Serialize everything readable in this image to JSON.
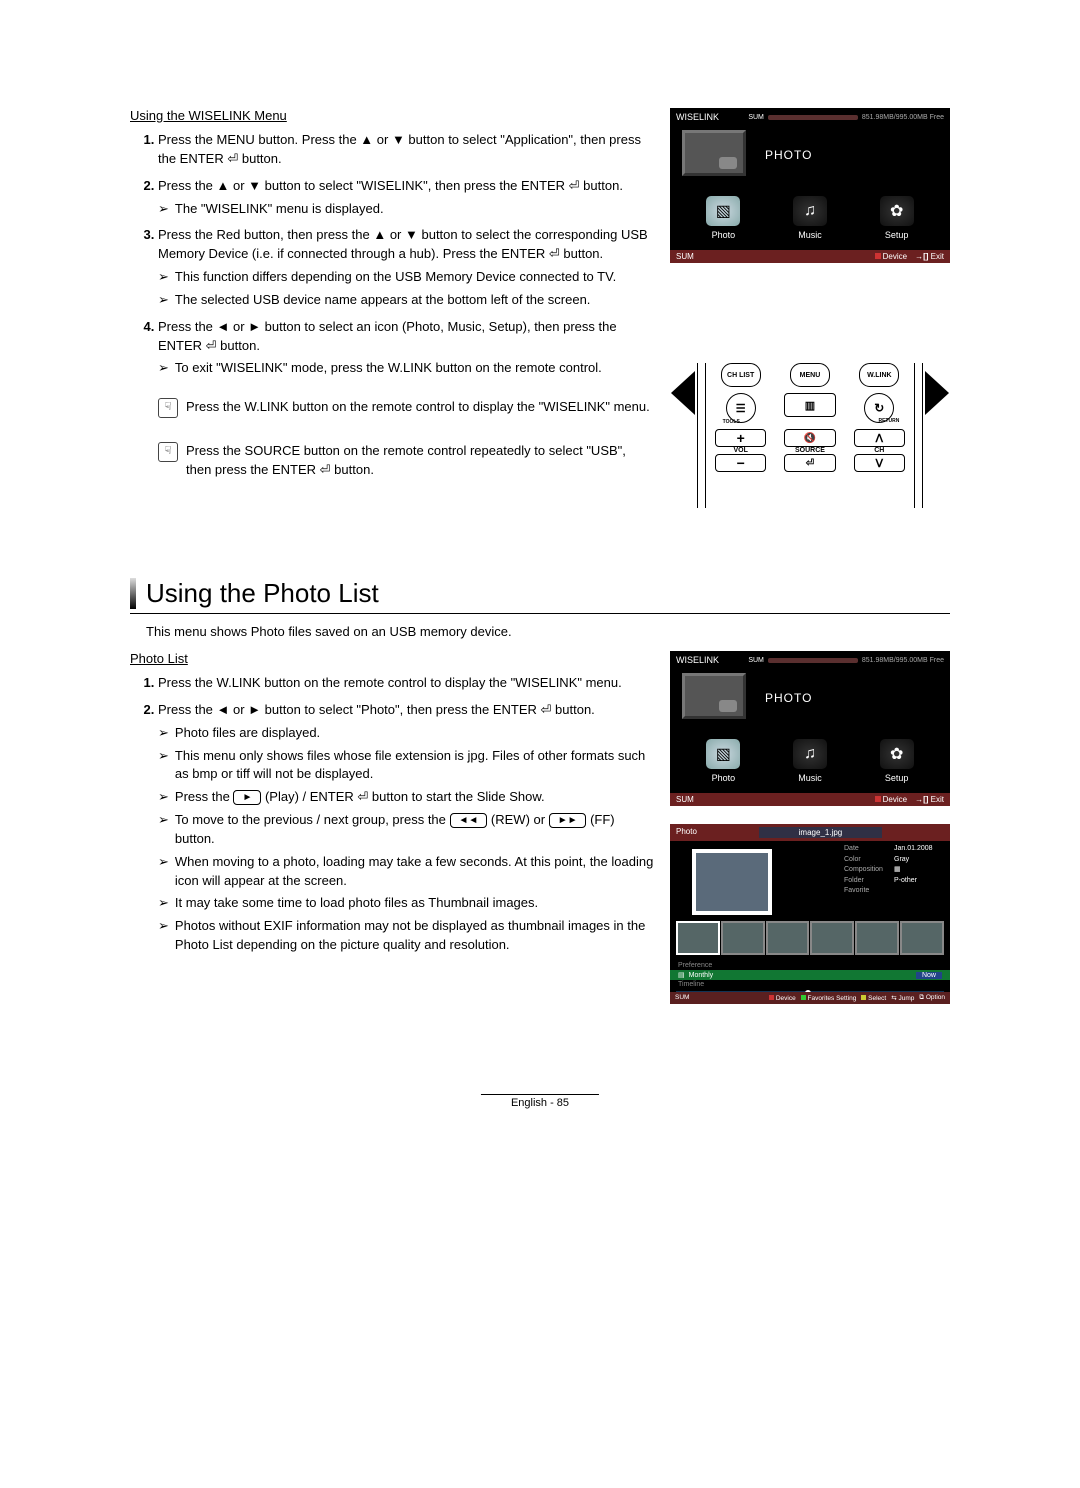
{
  "section1_title": "Using the WISELINK Menu",
  "steps1": {
    "s1": "Press the MENU button. Press the ▲ or ▼ button to select \"Application\", then press the ENTER ⏎ button.",
    "s2": "Press the ▲ or ▼ button to select \"WISELINK\", then press the ENTER ⏎ button.",
    "s2n1": "The \"WISELINK\" menu is displayed.",
    "s3": "Press the Red button, then press the ▲ or ▼ button to select the corresponding USB Memory Device (i.e. if connected through a hub). Press the ENTER ⏎ button.",
    "s3n1": "This function differs depending on the USB Memory Device connected to TV.",
    "s3n2": "The selected USB device name appears at the bottom left of the screen.",
    "s4": "Press the ◄ or ► button to select an icon (Photo, Music, Setup), then press the ENTER ⏎ button.",
    "s4n1": "To exit \"WISELINK\" mode, press the W.LINK button on the remote control."
  },
  "tip1": "Press the W.LINK button on the remote control to display the \"WISELINK\" menu.",
  "tip2": "Press the SOURCE button on the remote control repeatedly to select \"USB\", then press the ENTER ⏎ button.",
  "h2": "Using the Photo List",
  "h2_sub": "This menu shows Photo files saved on an USB memory device.",
  "section2_title": "Photo List",
  "steps2": {
    "s1": "Press the W.LINK button on the remote control to display the \"WISELINK\" menu.",
    "s2a": "Press the ◄ or ► button to select \"Photo\", then press the ENTER ⏎ button.",
    "s2n1": "Photo files are displayed.",
    "s2n2": "This menu only shows files whose file extension is jpg. Files of other formats such as bmp or tiff will not be displayed.",
    "s2n3a": "Press the ",
    "s2n3b": " (Play) / ENTER ⏎ button to start the Slide Show.",
    "s2n4a": "To move to the previous / next group, press the ",
    "s2n4b": " (REW) or ",
    "s2n4c": " (FF) button.",
    "s2n5": "When moving to a photo, loading may take a few seconds. At this point, the loading icon will appear at the screen.",
    "s2n6": "It may take some time to load photo files as Thumbnail images.",
    "s2n7": "Photos without EXIF information may not be displayed as thumbnail images in the Photo List depending on the picture quality and resolution."
  },
  "tv": {
    "title": "WISELINK",
    "free": "851.98MB/995.00MB Free",
    "sum": "SUM",
    "photo_label": "PHOTO",
    "icon_photo": "Photo",
    "icon_music": "Music",
    "icon_setup": "Setup",
    "footer_device": "Device",
    "footer_exit": "Exit"
  },
  "remote": {
    "chlist": "CH LIST",
    "menu": "MENU",
    "wlink": "W.LINK",
    "tools": "TOOLS",
    "return": "RETURN",
    "vol": "VOL",
    "source": "SOURCE",
    "ch": "CH",
    "plus": "+",
    "minus": "−",
    "mute": "🔇",
    "up": "ᐱ",
    "down": "ᐯ",
    "presrc": "⏎"
  },
  "pb": {
    "title": "Photo",
    "imgname": "image_1.jpg",
    "now": "Now",
    "info": {
      "date_k": "Date",
      "date_v": "Jan.01.2008",
      "color_k": "Color",
      "color_v": "Gray",
      "comp_k": "Composition",
      "comp_v": "▦",
      "folder_k": "Folder",
      "folder_v": "P-other",
      "fav_k": "Favorite"
    },
    "cat_pref": "Preference",
    "cat_monthly": "Monthly",
    "cat_timeline": "Timeline",
    "sum": "SUM",
    "f_device": "Device",
    "f_fav": "Favorites Setting",
    "f_select": "Select",
    "f_jump": "Jump",
    "f_option": "Option"
  },
  "play_icon": "►",
  "rew_icon": "◄◄",
  "ff_icon": "►►",
  "footer": "English - 85"
}
